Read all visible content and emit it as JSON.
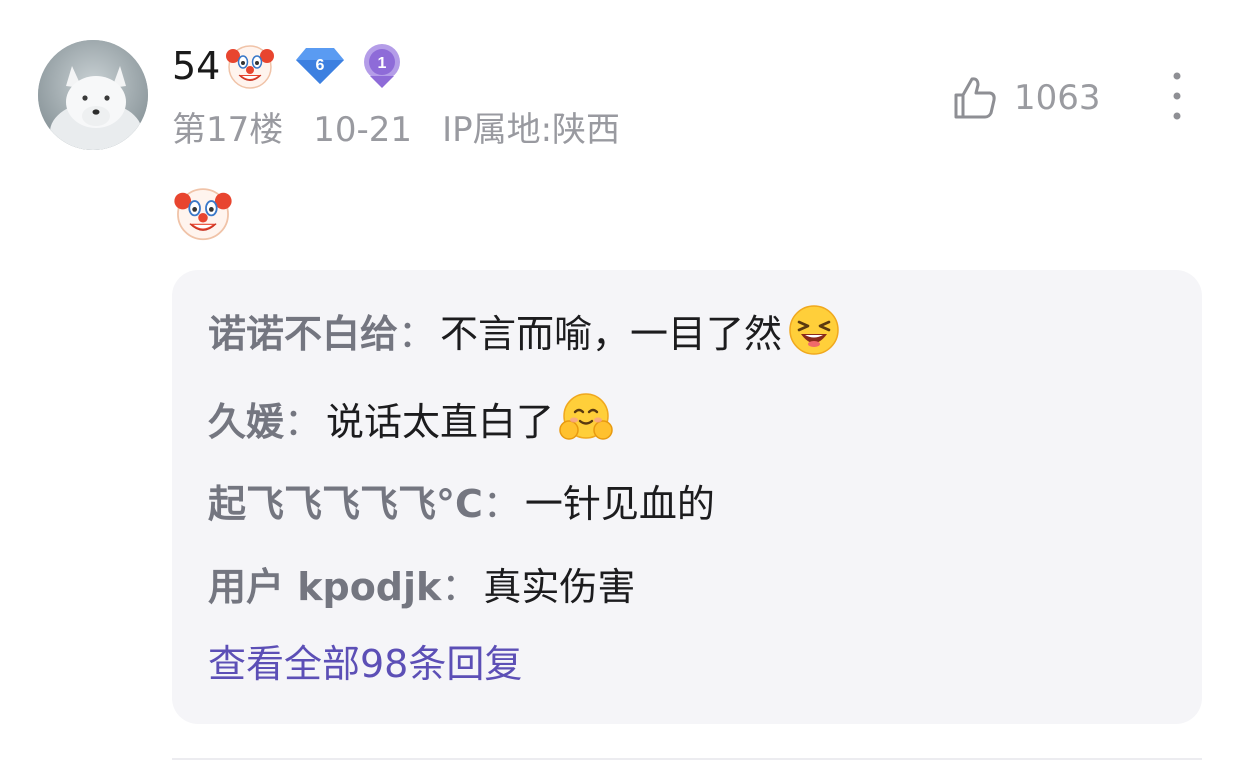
{
  "post": {
    "username": "54",
    "username_emoji": "clown-face-emoji",
    "level": "6",
    "medal": "1",
    "floor": "第17楼",
    "date": "10-21",
    "ip": "IP属地:陕西",
    "like_count": "1063",
    "content_emoji": "clown-face-emoji"
  },
  "replies": [
    {
      "author": "诺诺不白给",
      "colon": "：",
      "text": "不言而喻，一目了然",
      "emoji": "laughing-face-emoji"
    },
    {
      "author": "久媛",
      "colon": "：",
      "text": "说话太直白了",
      "emoji": "smiling-hands-face-emoji"
    },
    {
      "author": "起飞飞飞飞飞°C",
      "colon": "：",
      "text": "一针见血的"
    },
    {
      "author": "用户 kpodjk",
      "colon": "：",
      "text": "真实伤害"
    }
  ],
  "view_all_label": "查看全部98条回复",
  "colors": {
    "accent": "#5c4fb6",
    "reply_bg": "#f5f5f8",
    "meta_text": "#999aa0",
    "level_badge": "#4f8ff0",
    "medal_badge": "#8f6fd6"
  }
}
